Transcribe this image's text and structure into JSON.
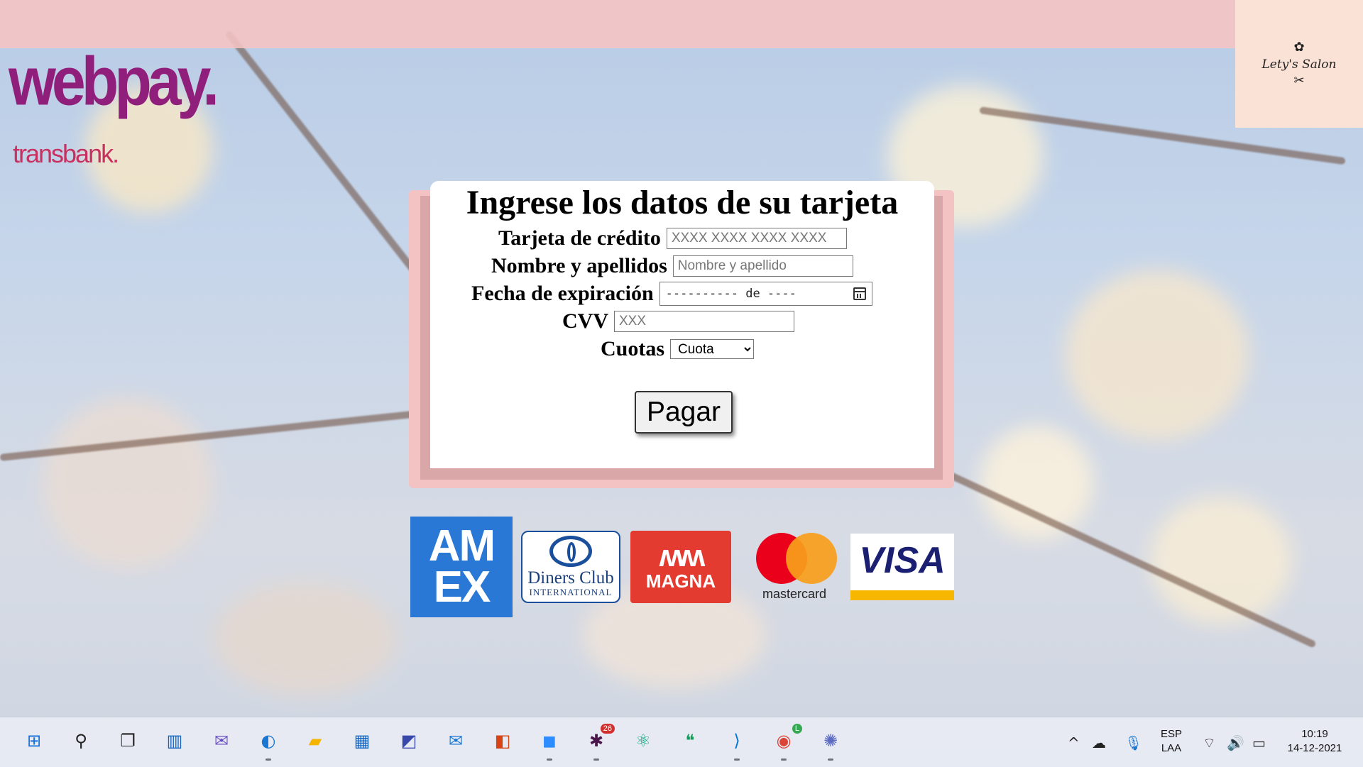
{
  "brand": {
    "webpay": "webpay.",
    "transbank": "transbank.",
    "salon_name": "Lety's Salon"
  },
  "form": {
    "title": "Ingrese los datos de su tarjeta",
    "card_label": "Tarjeta de crédito",
    "card_placeholder": "XXXX XXXX XXXX XXXX",
    "name_label": "Nombre y apellidos",
    "name_placeholder": "Nombre y apellido",
    "expiry_label": "Fecha de expiración",
    "expiry_value": "---------- de ----",
    "cvv_label": "CVV",
    "cvv_placeholder": "XXX",
    "installments_label": "Cuotas",
    "installments_selected": "Cuota",
    "pay_button": "Pagar"
  },
  "cards": {
    "amex_line1": "AM",
    "amex_line2": "EX",
    "diners_line1": "Diners Club",
    "diners_line2": "INTERNATIONAL",
    "magna": "MAGNA",
    "mastercard": "mastercard",
    "visa": "VISA"
  },
  "taskbar": {
    "slack_badge": "26",
    "chrome_badge": "L",
    "language": "ESP",
    "layout": "LAA",
    "time": "10:19",
    "date": "14-12-2021"
  },
  "colors": {
    "top_band": "#f6c4c4",
    "panel_border": "#f3c3c3",
    "webpay": "#8f1f7a",
    "transbank": "#c8305f"
  }
}
